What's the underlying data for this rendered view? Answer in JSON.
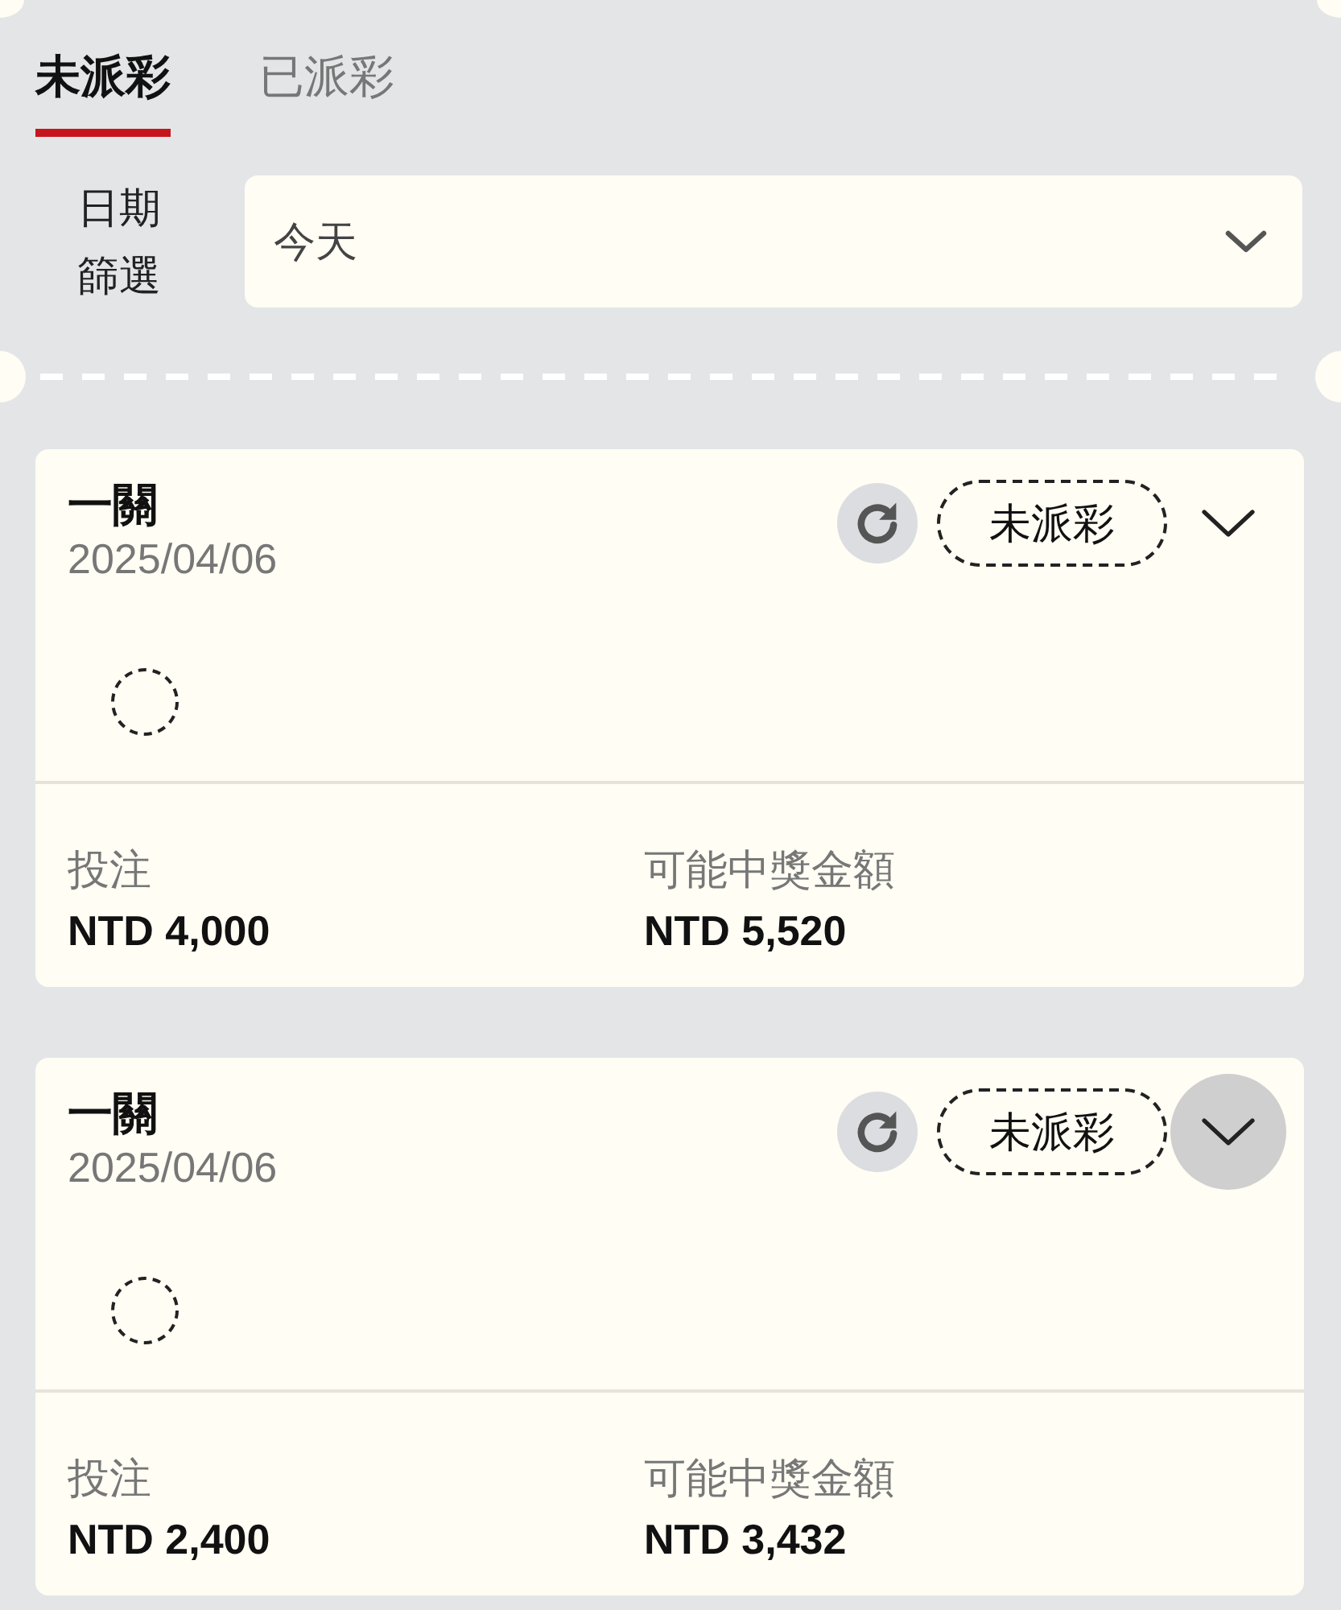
{
  "tabs": [
    {
      "label": "未派彩",
      "selected": true
    },
    {
      "label": "已派彩",
      "selected": false
    }
  ],
  "date_filter": {
    "label": "日期篩選",
    "value": "今天"
  },
  "bets": [
    {
      "title": "一關",
      "date": "2025/04/06",
      "status": "未派彩",
      "expand_highlighted": false,
      "stake_label": "投注",
      "stake": "NTD 4,000",
      "payout_label": "可能中獎金額",
      "payout": "NTD 5,520"
    },
    {
      "title": "一關",
      "date": "2025/04/06",
      "status": "未派彩",
      "expand_highlighted": true,
      "stake_label": "投注",
      "stake": "NTD 2,400",
      "payout_label": "可能中獎金額",
      "payout": "NTD 3,432"
    }
  ]
}
